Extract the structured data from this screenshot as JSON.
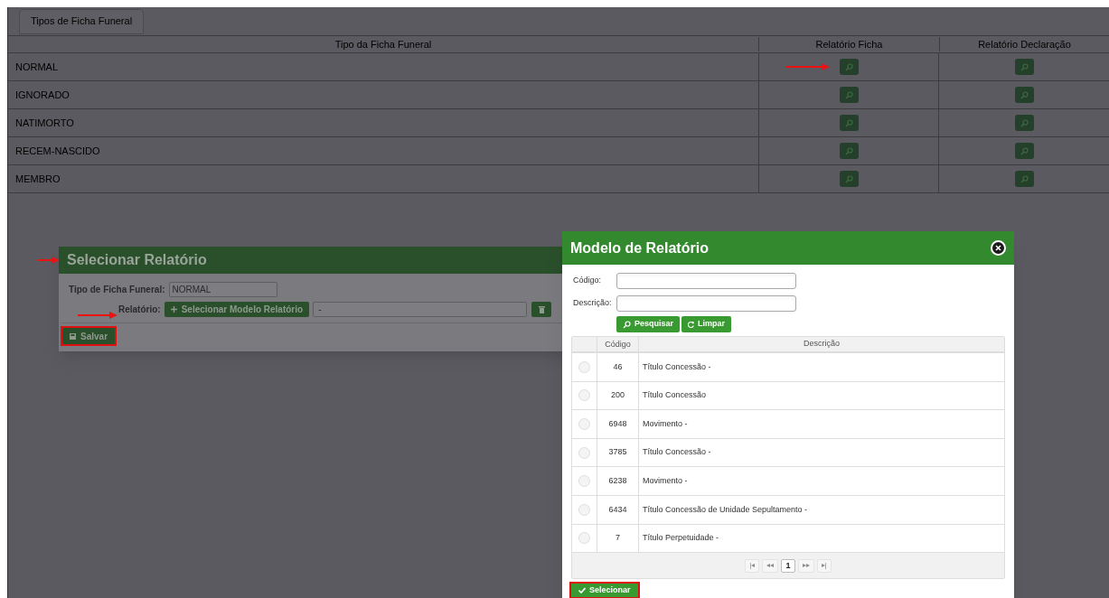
{
  "page": {
    "tab": "Tipos de Ficha Funeral",
    "table": {
      "columns": [
        "Tipo da Ficha Funeral",
        "Relatório Ficha",
        "Relatório Declaração"
      ],
      "rows": [
        {
          "name": "NORMAL",
          "marked": true
        },
        {
          "name": "IGNORADO",
          "marked": false
        },
        {
          "name": "NATIMORTO",
          "marked": false
        },
        {
          "name": "RECEM-NASCIDO",
          "marked": false
        },
        {
          "name": "MEMBRO",
          "marked": false
        }
      ]
    }
  },
  "select_dialog": {
    "title": "Selecionar Relatório",
    "title_marked": true,
    "type_label": "Tipo de Ficha Funeral:",
    "type_value": "NORMAL",
    "report_label": "Relatório:",
    "report_marked": true,
    "select_button": "Selecionar Modelo Relatório",
    "report_value": "-",
    "save_button": {
      "label": "Salvar",
      "highlighted": true
    }
  },
  "model_dialog": {
    "title": "Modelo de Relatório",
    "fields": [
      {
        "label": "Código:"
      },
      {
        "label": "Descrição:"
      }
    ],
    "search_button": "Pesquisar",
    "clear_button": "Limpar",
    "columns": [
      "Código",
      "Descrição"
    ],
    "rows": [
      {
        "code": "46",
        "description": "Título Concessão -",
        "selected": false
      },
      {
        "code": "200",
        "description": "Título Concessão",
        "selected": false
      },
      {
        "code": "6948",
        "description": "Movimento -",
        "selected": false
      },
      {
        "code": "3785",
        "description": "Título Concessão -",
        "selected": false
      },
      {
        "code": "6238",
        "description": "Movimento -",
        "selected": false
      },
      {
        "code": "6434",
        "description": "Título Concessão de Unidade Sepultamento -",
        "selected": false
      },
      {
        "code": "7",
        "description": "Título Perpetuidade -",
        "selected": false
      }
    ],
    "pager": [
      {
        "label": "|◂",
        "current": false
      },
      {
        "label": "◂◂",
        "current": false
      },
      {
        "label": "1",
        "current": true
      },
      {
        "label": "▸▸",
        "current": false
      },
      {
        "label": "▸|",
        "current": false
      }
    ],
    "confirm_button": {
      "label": "Selecionar",
      "highlighted": true
    }
  }
}
